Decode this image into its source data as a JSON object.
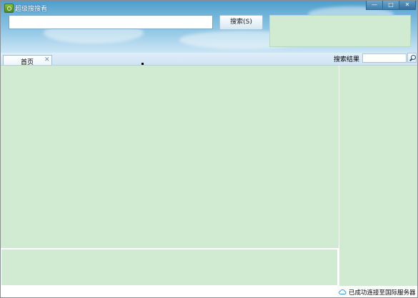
{
  "window": {
    "title": "超级搜搜看",
    "controls": {
      "minimize": "—",
      "maximize": "□",
      "close": "✕"
    }
  },
  "search": {
    "value": "",
    "placeholder": "",
    "button_label": "搜索(S)"
  },
  "tabs": [
    {
      "label": "首页",
      "close": "✕"
    }
  ],
  "results": {
    "label": "搜索结果",
    "filter_value": ""
  },
  "status": {
    "text": "已成功连接至国际服务器",
    "icon": "cloud-icon"
  },
  "colors": {
    "content_background": "#d0ebd2",
    "header_top": "#4f9ccb",
    "header_bottom": "#cbe5f4"
  }
}
